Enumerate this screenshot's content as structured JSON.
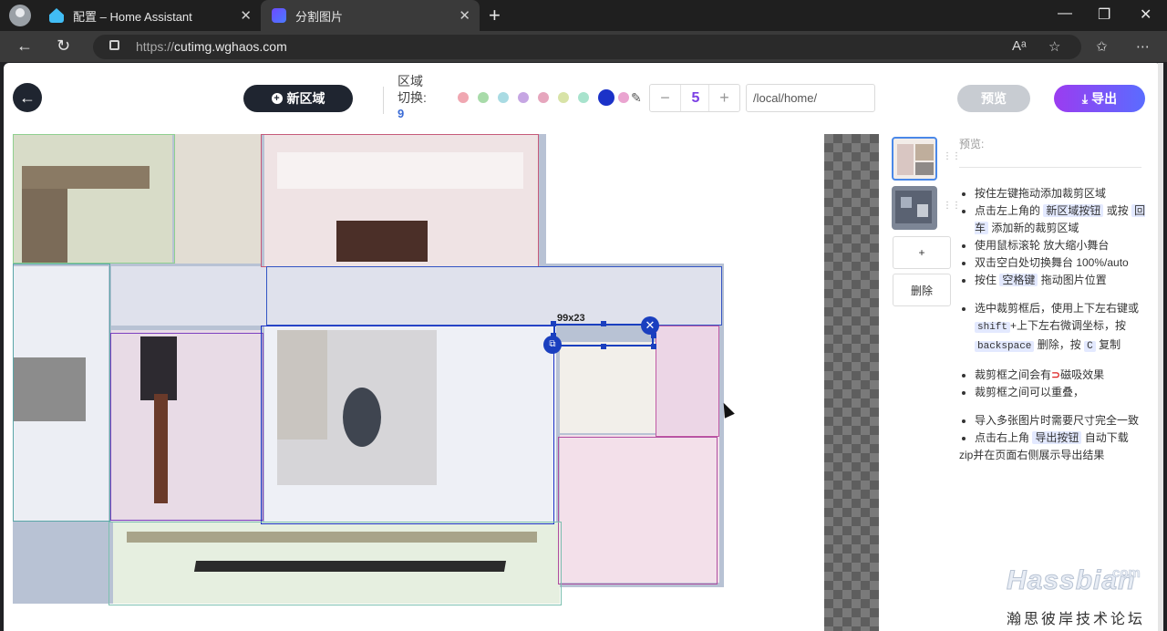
{
  "browser": {
    "tabs": [
      {
        "title": "配置 – Home Assistant"
      },
      {
        "title": "分割图片"
      }
    ],
    "new_tab": "+",
    "url_scheme": "https://",
    "url_host": "cutimg.wghaos.com",
    "window_controls": {
      "minimize": "—",
      "restore": "❐",
      "close": "✕"
    }
  },
  "toolbar": {
    "back": "←",
    "new_region_label": "新区域",
    "region_switch_label_line1": "区域",
    "region_switch_label_line2": "切换:",
    "region_count": "9",
    "colors": [
      "#f0a7b1",
      "#a8dba9",
      "#a9dbe3",
      "#c6a6e3",
      "#e6a6bd",
      "#d8e3a7",
      "#a8e3cd",
      "#1b32c8",
      "#eaa4d0"
    ],
    "step_minus": "−",
    "step_value": "5",
    "step_plus": "+",
    "path_value": "/local/home/",
    "preview_label": "预览",
    "export_label": "导出"
  },
  "stage": {
    "selection_size": "99x23"
  },
  "sidebar": {
    "add_label": "+",
    "delete_label": "删除",
    "preview_label": "预览:",
    "tips": {
      "t1": "按住左键拖动添加裁剪区域",
      "t2a": "点击左上角的",
      "t2k": "新区域按钮",
      "t2b": "或按",
      "t2k2": "回车",
      "t2c": "添加新的裁剪区域",
      "t3": "使用鼠标滚轮 放大缩小舞台",
      "t4": "双击空白处切换舞台 100%/auto",
      "t5a": "按住",
      "t5k": "空格键",
      "t5b": "拖动图片位置",
      "t6a": "选中裁剪框后，使用上下左右键或",
      "t6k": "shift",
      "t6b": "+上下左右微调坐标，按",
      "t6k2": "backspace",
      "t6c": "删除，按",
      "t6k3": "C",
      "t6d": "复制",
      "t7a": "裁剪框之间会有",
      "t7b": "磁吸效果",
      "t8": "裁剪框之间可以重叠，",
      "t9": "导入多张图片时需要尺寸完全一致",
      "t10a": "点击右上角",
      "t10k": "导出按钮",
      "t10b": "自动下载",
      "t10c": "zip并在页面右侧展示导出结果"
    }
  },
  "watermark": {
    "brand": "Hassbian",
    "com": "com",
    "subtitle": "瀚思彼岸技术论坛"
  }
}
